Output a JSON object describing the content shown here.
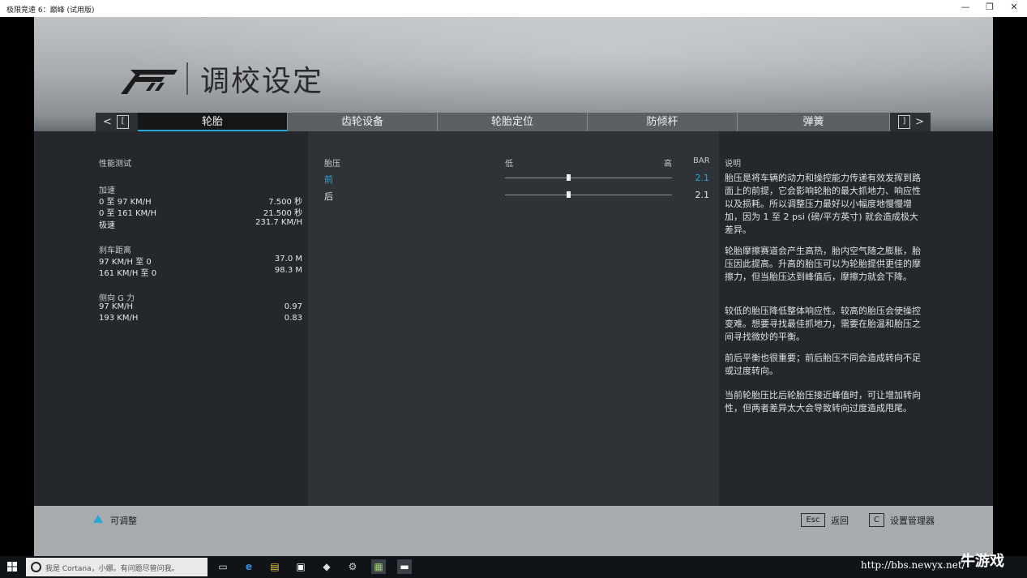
{
  "window": {
    "title": "极限竞速 6：巅峰 (试用版)",
    "min_glyph": "—",
    "max_glyph": "❐",
    "close_glyph": "✕"
  },
  "header": {
    "title": "调校设定",
    "logo_icon": "forza-logo-icon"
  },
  "tabs": {
    "prev_arrow": "<",
    "prev_key": "[",
    "next_key": "]",
    "next_arrow": ">",
    "items": [
      {
        "label": "轮胎",
        "active": true
      },
      {
        "label": "齿轮设备",
        "active": false
      },
      {
        "label": "轮胎定位",
        "active": false
      },
      {
        "label": "防倾杆",
        "active": false
      },
      {
        "label": "弹簧",
        "active": false
      }
    ]
  },
  "stats": {
    "title": "性能测试",
    "acceleration": {
      "title": "加速",
      "rows": [
        {
          "label": "0 至 97 KM/H",
          "value": "7.500 秒"
        },
        {
          "label": "0 至 161 KM/H",
          "value": "21.500 秒"
        },
        {
          "label": "极速",
          "value": "231.7 KM/H"
        }
      ]
    },
    "braking": {
      "title": "刹车距离",
      "rows": [
        {
          "label": "97 KM/H 至 0",
          "value": "37.0 M"
        },
        {
          "label": "161 KM/H 至 0",
          "value": "98.3 M"
        }
      ]
    },
    "lateral": {
      "title": "侧向 G 力",
      "rows": [
        {
          "label": "97 KM/H",
          "value": "0.97"
        },
        {
          "label": "193 KM/H",
          "value": "0.83"
        }
      ]
    }
  },
  "tire_pressure": {
    "title": "胎压",
    "low_label": "低",
    "high_label": "高",
    "unit": "BAR",
    "sliders": [
      {
        "label": "前",
        "value": "2.1",
        "level": 0.38,
        "selected": true
      },
      {
        "label": "后",
        "value": "2.1",
        "level": 0.38,
        "selected": false
      }
    ]
  },
  "description": {
    "title": "说明",
    "paragraphs": [
      "胎压是将车辆的动力和操控能力传递有效发挥到路面上的前提，它会影响轮胎的最大抓地力、响应性以及损耗。所以调整压力最好以小幅度地慢慢增加，因为 1 至 2 psi (磅/平方英寸) 就会造成极大差异。",
      "轮胎摩擦赛道会产生高热，胎内空气随之膨胀，胎压因此提高。升高的胎压可以为轮胎提供更佳的摩擦力，但当胎压达到峰值后，摩擦力就会下降。",
      "较低的胎压降低整体响应性。较高的胎压会使操控变难。想要寻找最佳抓地力，需要在胎温和胎压之间寻找微妙的平衡。",
      "前后平衡也很重要；前后胎压不同会造成转向不足或过度转向。",
      "当前轮胎压比后轮胎压接近峰值时，可让增加转向性，但两者差异太大会导致转向过度造成甩尾。"
    ]
  },
  "footer": {
    "adjustable_label": "可调整",
    "esc_key": "Esc",
    "back_label": "返回",
    "c_key": "C",
    "manager_label": "设置管理器"
  },
  "taskbar": {
    "search_placeholder": "我是 Cortana，小娜。有问题尽管问我。",
    "watermark": "http://bbs.newyx.net/",
    "brand": "牛游戏"
  },
  "colors": {
    "accent": "#29a8d8",
    "panel": "#262a2f",
    "footer": "#a7abae"
  }
}
